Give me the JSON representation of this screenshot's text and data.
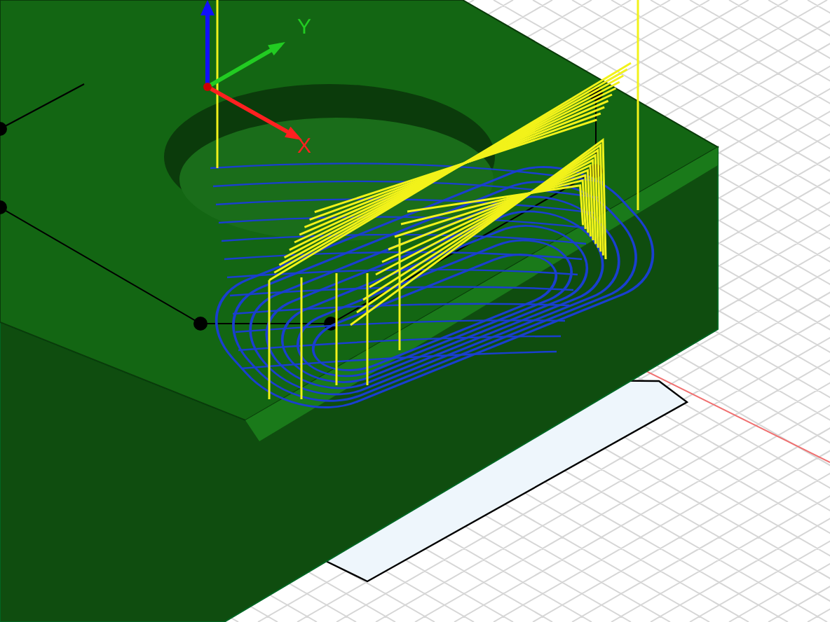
{
  "viewport": {
    "axes": [
      {
        "kind": "y",
        "label": "Y"
      },
      {
        "kind": "x",
        "label": "X"
      }
    ]
  }
}
